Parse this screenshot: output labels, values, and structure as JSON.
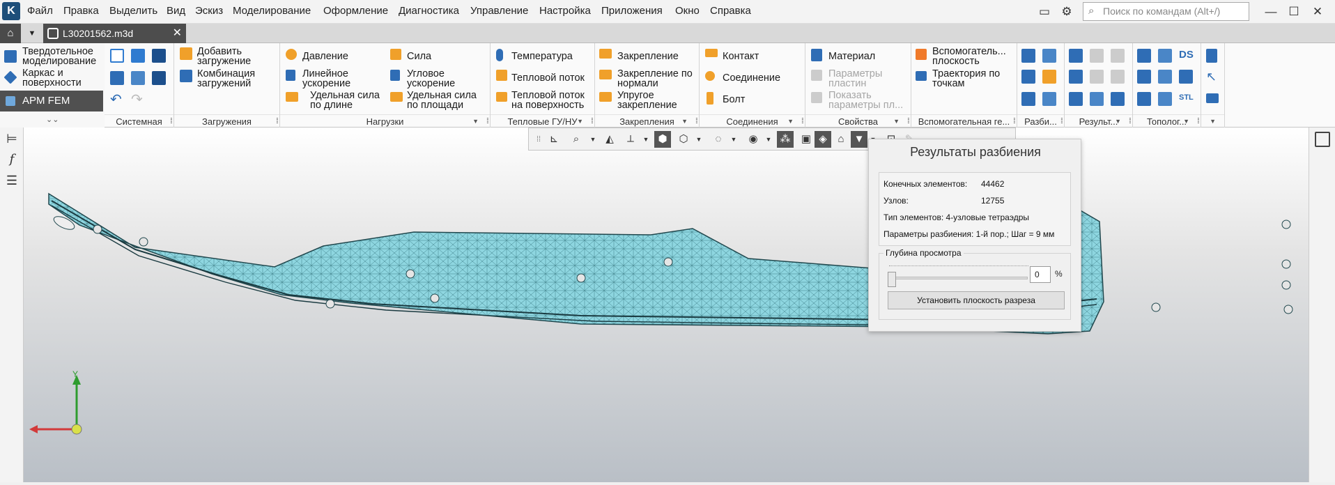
{
  "menu": {
    "items": [
      "Файл",
      "Правка",
      "Выделить",
      "Вид",
      "Эскиз",
      "Моделирование",
      "Оформление",
      "Диагностика",
      "Управление",
      "Настройка",
      "Приложения",
      "Окно",
      "Справка"
    ],
    "search_placeholder": "Поиск по командам (Alt+/)"
  },
  "tabs": {
    "document": "L30201562.m3d",
    "close_glyph": "✕"
  },
  "ribbon": {
    "modes": [
      "Твердотельное\nмоделирование",
      "Каркас и\nповерхности",
      "APM FEM"
    ],
    "groups": {
      "system": {
        "title": "Системная"
      },
      "loads": {
        "title": "Загружения",
        "add": "Добавить\nзагружение",
        "combo": "Комбинация\nзагружений"
      },
      "forces": {
        "title": "Нагрузки",
        "items": [
          "Давление",
          "Сила",
          "Линейное\nускорение",
          "Угловое\nускорение",
          "Удельная сила\nпо длине",
          "Удельная сила\nпо площади"
        ]
      },
      "thermal": {
        "title": "Тепловые ГУ/НУ",
        "items": [
          "Температура",
          "Тепловой поток",
          "Тепловой поток\nна поверхность"
        ]
      },
      "fixings": {
        "title": "Закрепления",
        "items": [
          "Закрепление",
          "Закрепление по\nнормали",
          "Упругое\nзакрепление"
        ]
      },
      "joints": {
        "title": "Соединения",
        "items": [
          "Контакт",
          "Соединение",
          "Болт"
        ]
      },
      "props": {
        "title": "Свойства",
        "items": [
          "Материал",
          "Параметры\nпластин",
          "Показать\nпараметры пл..."
        ]
      },
      "aux": {
        "title": "Вспомогательная ге...",
        "items": [
          "Вспомогатель...\nплоскость",
          "Траектория по\nточкам"
        ]
      },
      "mesh": {
        "title": "Разби..."
      },
      "results": {
        "title": "Результ..."
      },
      "topo": {
        "title": "Тополог..."
      }
    }
  },
  "panel": {
    "title": "Результаты разбиения",
    "stats": [
      {
        "label": "Конечных элементов:",
        "value": "44462"
      },
      {
        "label": "Узлов:",
        "value": "12755"
      },
      {
        "label": "Тип элементов:",
        "value": "4-узловые тетраэдры"
      },
      {
        "label": "Параметры разбиения:",
        "value": "1-й пор.; Шаг = 9 мм"
      }
    ],
    "depth_label": "Глубина просмотра",
    "depth_value": "0",
    "depth_unit": "%",
    "cut_button": "Установить плоскость разреза"
  },
  "axes": {
    "y": "Y"
  },
  "colors": {
    "mesh": "#8ed6e0",
    "accent_dark": "#505050"
  }
}
